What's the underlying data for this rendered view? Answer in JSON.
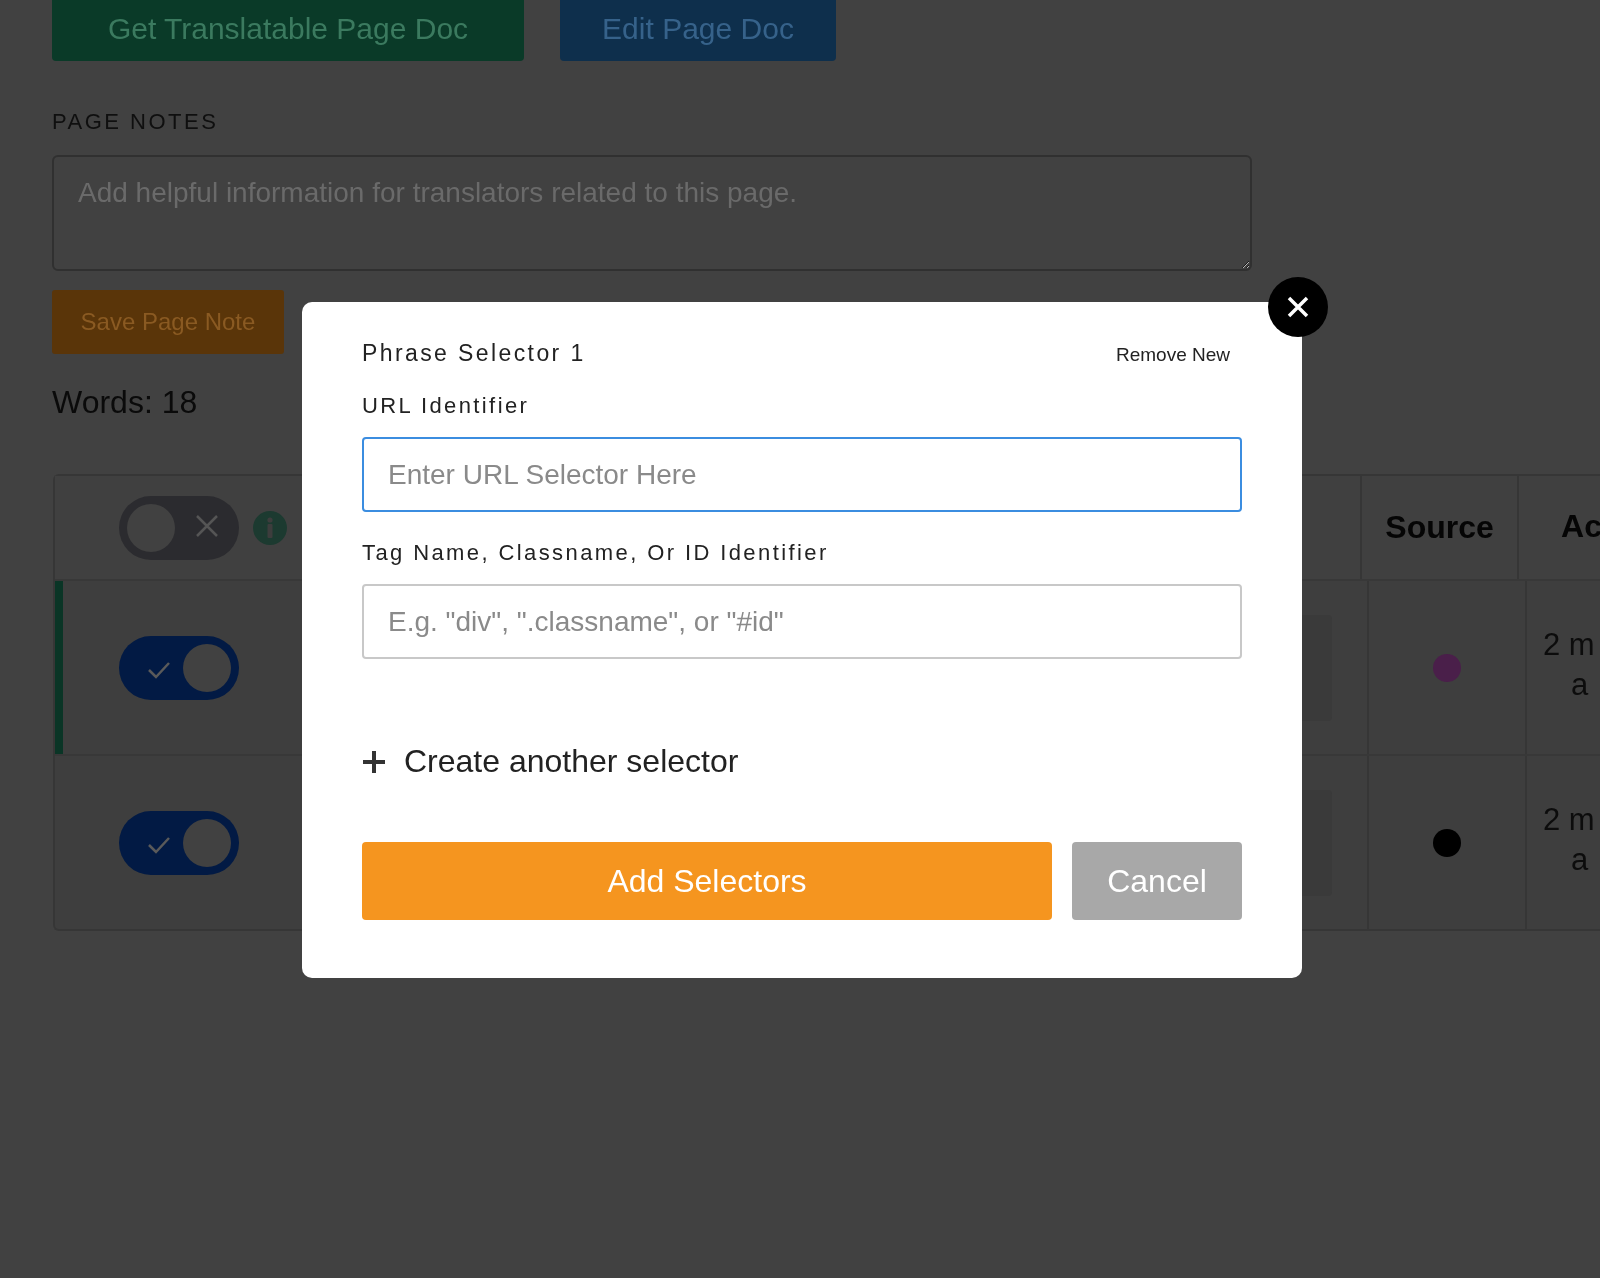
{
  "toolbar": {
    "buttons": [
      {
        "label": "Get Translatable Page Doc",
        "kind": "primary"
      },
      {
        "label": "Edit Page Doc",
        "kind": "secondary"
      }
    ]
  },
  "page_notes": {
    "title": "PAGE NOTES",
    "placeholder": "Add helpful information for translators related to this page.",
    "save_button": "Save Page Note"
  },
  "word_count": "Words: 18",
  "table": {
    "header": {
      "on": false
    },
    "columns": [
      "Source",
      "Ac"
    ],
    "rows": [
      {
        "selected": true,
        "on": true,
        "color": "#4a1f4a",
        "added": [
          "2 m",
          "a"
        ]
      },
      {
        "selected": false,
        "on": true,
        "color": "#000000",
        "added": [
          "2 m",
          "a"
        ]
      }
    ]
  },
  "modal": {
    "title": "Phrase Selector 1",
    "remove_link": "Remove New",
    "url_label": "URL Identifier",
    "url_placeholder": "Enter URL Selector Here",
    "url_focused": true,
    "tag_label": "Tag Name, Classname, Or ID Identifier",
    "tag_placeholder": "E.g. \"div\", \".classname\", or \"#id\"",
    "add_another": "Create another selector",
    "primary_button": "Add Selectors",
    "cancel_button": "Cancel"
  }
}
